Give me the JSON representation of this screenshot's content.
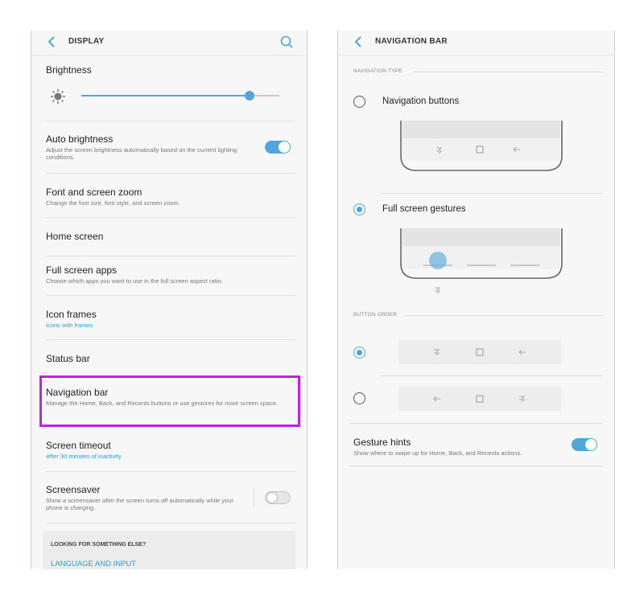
{
  "display": {
    "header": {
      "title": "DISPLAY"
    },
    "brightness": {
      "label": "Brightness",
      "level": 0.85
    },
    "items": [
      {
        "title": "Auto brightness",
        "sub": "Adjust the screen brightness automatically based on the current lighting conditions.",
        "toggle": "on"
      },
      {
        "title": "Font and screen zoom",
        "sub": "Change the font size, font style, and screen zoom."
      },
      {
        "title": "Home screen",
        "sub": ""
      },
      {
        "title": "Full screen apps",
        "sub": "Choose which apps you want to use in the full screen aspect ratio."
      },
      {
        "title": "Icon frames",
        "sub": "Icons with frames"
      },
      {
        "title": "Status bar",
        "sub": ""
      },
      {
        "title": "Navigation bar",
        "sub": "Manage the Home, Back, and Recents buttons or use gestures for more screen space."
      },
      {
        "title": "Screen timeout",
        "sub": "After 30 minutes of inactivity"
      },
      {
        "title": "Screensaver",
        "sub": "Show a screensaver after the screen turns off automatically while your phone is charging.",
        "toggle": "off"
      }
    ],
    "looking": {
      "heading": "LOOKING FOR SOMETHING ELSE?",
      "link": "LANGUAGE AND INPUT"
    },
    "highlight_color": "#c21fe0"
  },
  "navbar": {
    "header": {
      "title": "NAVIGATION BAR"
    },
    "section_type": "NAVIGATION TYPE",
    "options": [
      {
        "label": "Navigation buttons",
        "selected": false
      },
      {
        "label": "Full screen gestures",
        "selected": true
      }
    ],
    "section_order": "BUTTON ORDER",
    "orders": [
      {
        "selected": true,
        "icons": [
          "recents-icon",
          "home-icon",
          "back-icon"
        ]
      },
      {
        "selected": false,
        "icons": [
          "back-icon",
          "home-icon",
          "recents-icon"
        ]
      }
    ],
    "gesture_hints": {
      "title": "Gesture hints",
      "sub": "Show where to swipe up for Home, Back, and Recents actions.",
      "toggle": "on"
    }
  },
  "colors": {
    "accent": "#4ea6dc",
    "link": "#2e9cd6",
    "highlight": "#c21fe0"
  }
}
